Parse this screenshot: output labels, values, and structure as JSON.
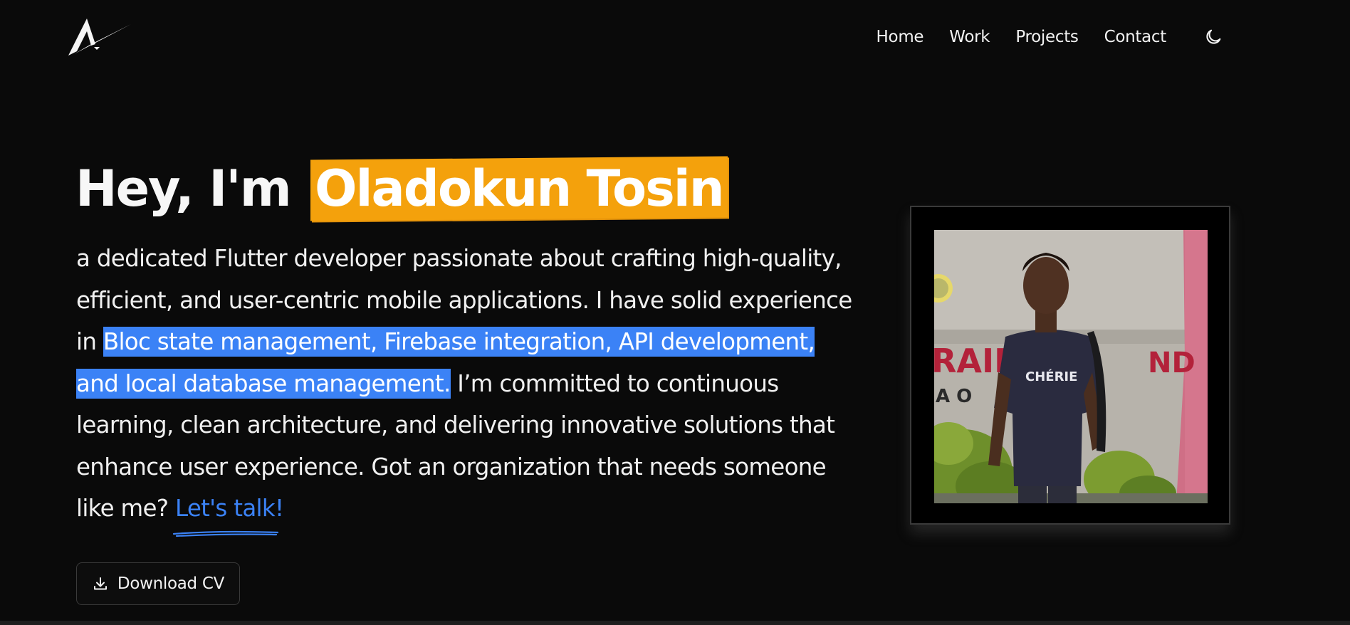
{
  "nav": {
    "links": [
      "Home",
      "Work",
      "Projects",
      "Contact"
    ],
    "theme_icon": "moon-icon"
  },
  "hero": {
    "greeting": "Hey, I'm",
    "name": "Oladokun Tosin",
    "bio_part1": "a dedicated Flutter developer passionate about crafting high-quality, efficient, and user-centric mobile applications. I have solid experience in",
    "bio_highlight": "Bloc state management, Firebase integration, API development, and local database management.",
    "bio_part2": "I’m committed to continuous learning, clean architecture, and delivering innovative solutions that enhance user experience. Got an organization that needs someone like me?",
    "cta_link": "Let's talk!",
    "download_label": "Download CV",
    "download_icon": "download-icon"
  },
  "colors": {
    "background": "#0a0a0a",
    "name_highlight": "#f4a10c",
    "text_highlight": "#3b82f6",
    "link": "#3b82f6"
  },
  "photo": {
    "sign_text_left": "RAIN",
    "sign_text_right": "ND",
    "sign_text_row2": "A O",
    "shirt_text": "CHÉRIE"
  }
}
